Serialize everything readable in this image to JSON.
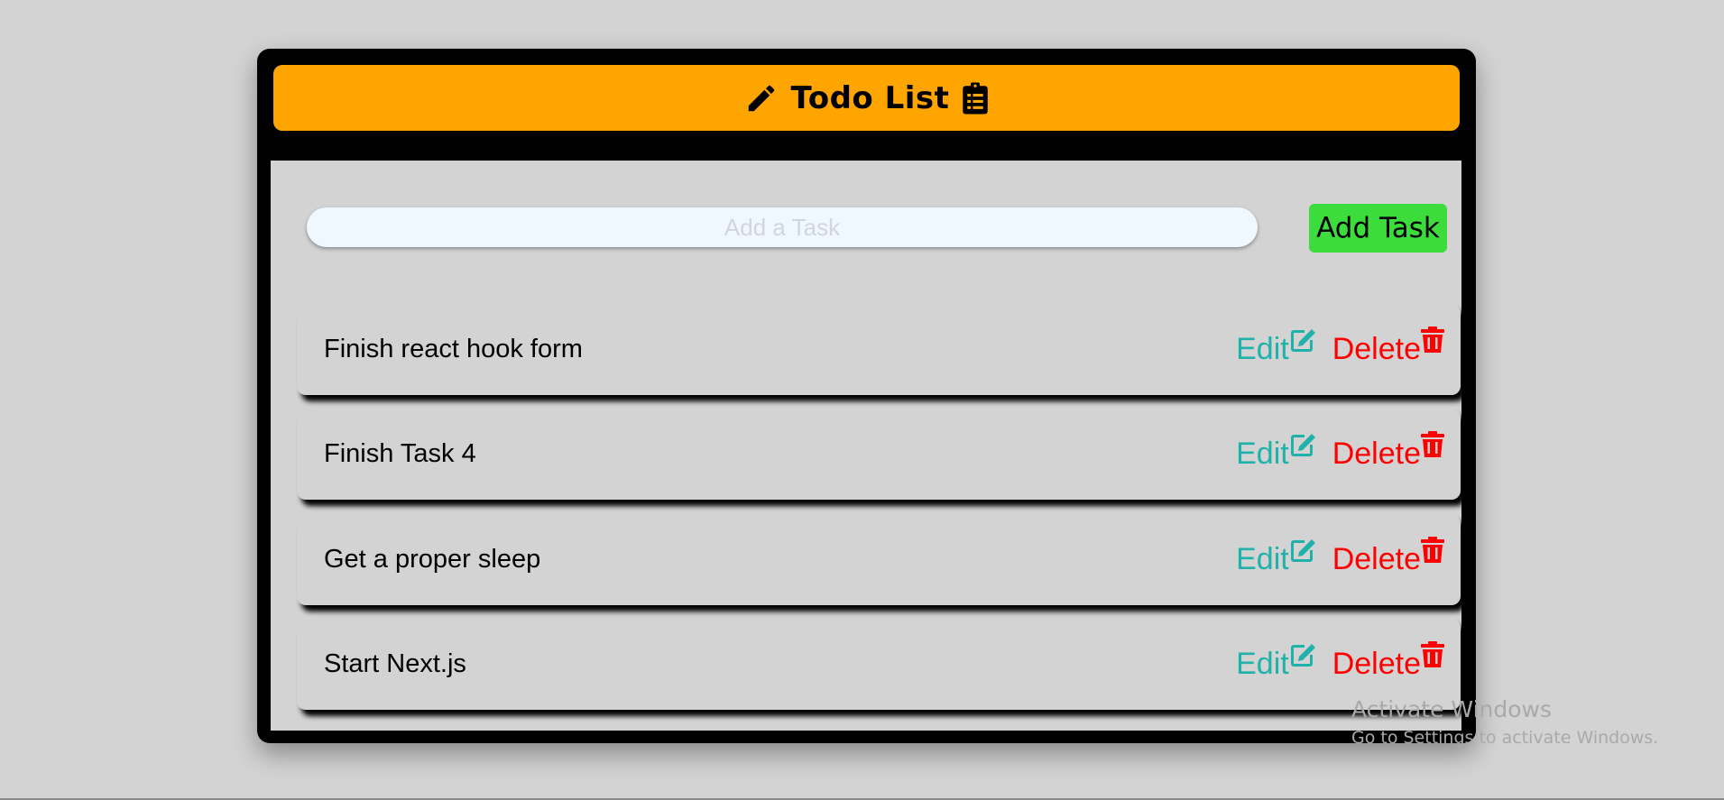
{
  "header": {
    "title": "Todo List",
    "left_icon": "pencil-icon",
    "right_icon": "clipboard-list-icon",
    "background": "#ffa500"
  },
  "input": {
    "placeholder": "Add a Task",
    "value": ""
  },
  "add_button": {
    "label": "Add Task",
    "color": "#3ddc3d"
  },
  "tasks": [
    {
      "label": "Finish react hook form",
      "edit_label": "Edit",
      "delete_label": "Delete"
    },
    {
      "label": "Finish Task 4",
      "edit_label": "Edit",
      "delete_label": "Delete"
    },
    {
      "label": "Get a proper sleep",
      "edit_label": "Edit",
      "delete_label": "Delete"
    },
    {
      "label": "Start Next.js",
      "edit_label": "Edit",
      "delete_label": "Delete"
    }
  ],
  "colors": {
    "edit": "#20b2aa",
    "delete": "#ff0000",
    "frame": "#000000",
    "page_background": "#d3d3d3"
  },
  "watermark": {
    "title": "Activate Windows",
    "subtitle": "Go to Settings to activate Windows."
  }
}
